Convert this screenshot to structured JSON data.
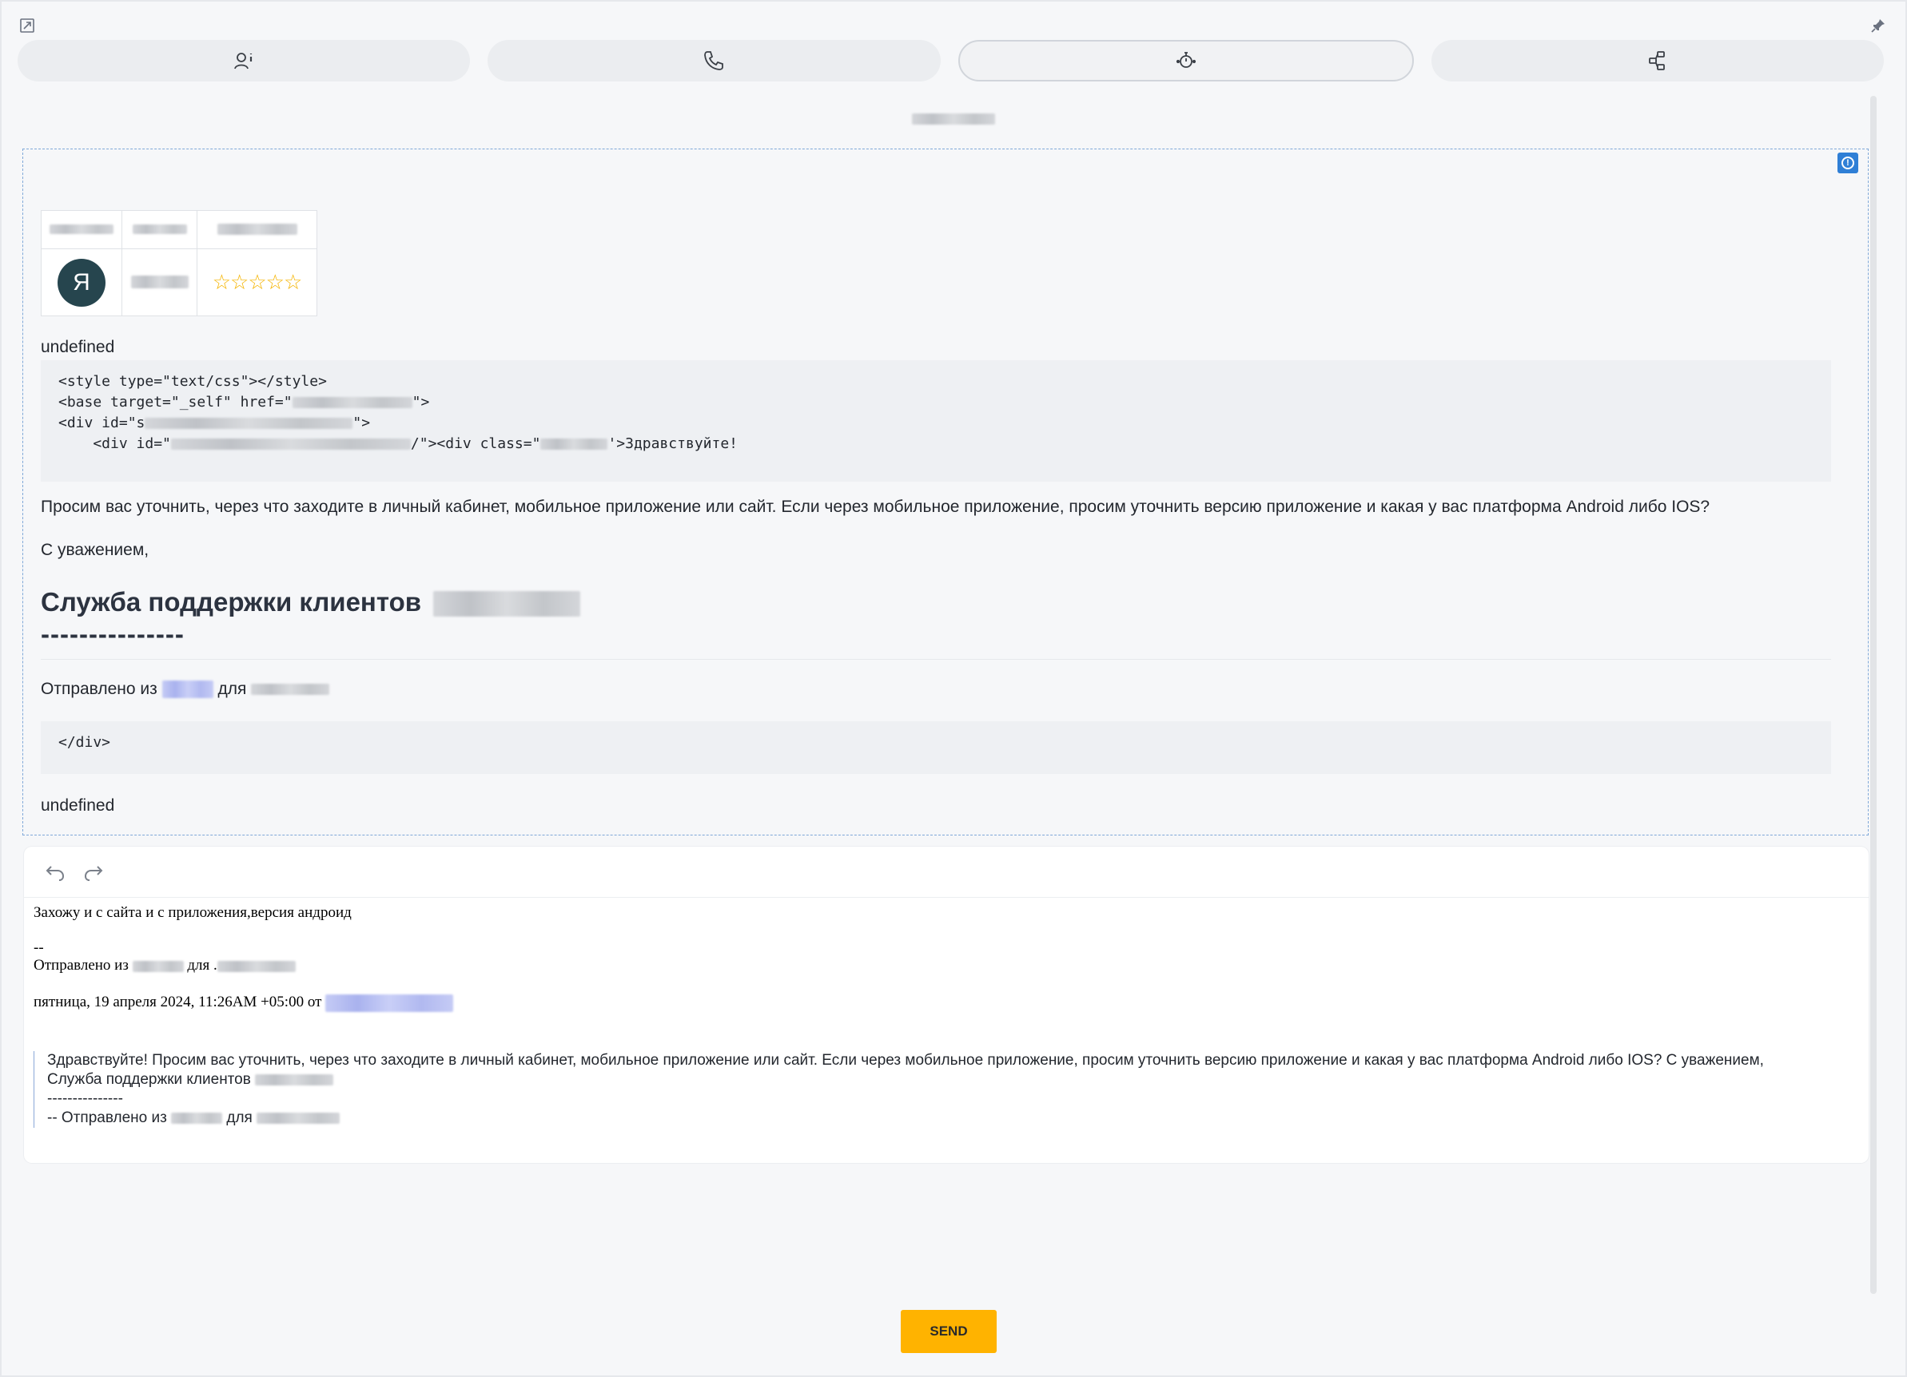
{
  "icons": {
    "expand": "expand-icon",
    "pin": "pin-icon"
  },
  "tabs": [
    {
      "icon": "contact-info-icon",
      "active": false
    },
    {
      "icon": "phone-icon",
      "active": false
    },
    {
      "icon": "timer-icon",
      "active": true
    },
    {
      "icon": "workflow-icon",
      "active": false
    }
  ],
  "message": {
    "undefined_top": "undefined",
    "avatar_letter": "Я",
    "stars": "☆☆☆☆☆",
    "code_block_1": {
      "line1": "<style type=\"text/css\"></style>",
      "line2_prefix": "<base target=\"_self\" href=\"",
      "line2_suffix": "\">",
      "line3_prefix": "<div id=\"s",
      "line3_suffix": "\">",
      "line4_prefix": "    <div id=\"",
      "line4_mid": "/\"><div class=\"",
      "line4_suffix": "'>Здравствуйте!"
    },
    "body_text": "Просим вас уточнить, через что заходите в личный кабинет, мобильное приложение или сайт. Если через мобильное приложение, просим уточнить версию приложение и какая у вас платформа Android либо IOS?",
    "regards": "С уважением,",
    "signature_heading": "Служба поддержки клиентов",
    "dashes": "---------------",
    "sent_from": "Отправлено из",
    "sent_for": "для",
    "code_block_2": "</div>",
    "undefined_bottom": "undefined"
  },
  "editor": {
    "undo_icon": "undo-icon",
    "redo_icon": "redo-icon",
    "reply_line": "Захожу и с сайта и с приложения,версия андроид",
    "separator": "--",
    "sent_from": "Отправлено из",
    "sent_for": "для .",
    "date_line": "пятница, 19 апреля 2024, 11:26AM +05:00 от",
    "quote_line1": "Здравствуйте! Просим вас уточнить, через что заходите в личный кабинет, мобильное приложение или сайт. Если через мобильное приложение, просим уточнить версию приложение и какая у вас платформа Android либо IOS? С уважением,",
    "quote_line2": "Служба поддержки клиентов",
    "quote_line3": "---------------",
    "quote_line4_prefix": "-- Отправлено из",
    "quote_line4_mid": "для"
  },
  "actions": {
    "send_label": "SEND"
  },
  "colors": {
    "send_button": "#ffb300",
    "info_badge": "#2f7fd6",
    "avatar_bg": "#26454e"
  }
}
